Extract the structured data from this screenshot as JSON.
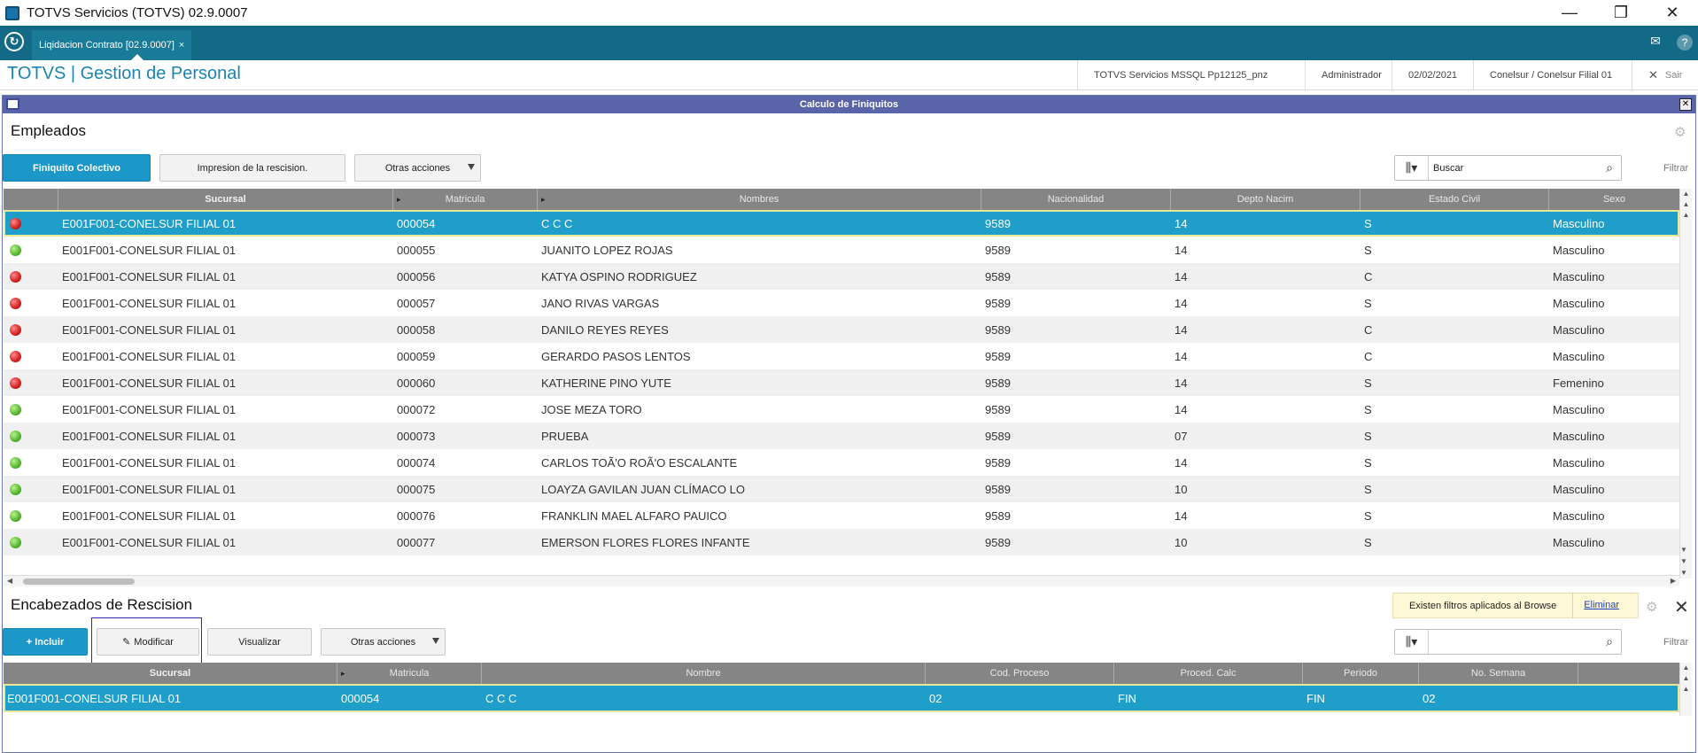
{
  "window": {
    "title": "TOTVS Servicios (TOTVS) 02.9.0007",
    "minimize": "—",
    "restore": "❐",
    "close": "✕"
  },
  "tabbar": {
    "tab_label": "Liqidacion Contrato [02.9.0007]",
    "tab_close": "×",
    "mail_icon": "✉",
    "help_icon": "?"
  },
  "header": {
    "brand": "TOTVS | Gestion de Personal",
    "environment": "TOTVS Servicios MSSQL Pp12125_pnz",
    "user": "Administrador",
    "date": "02/02/2021",
    "branch": "Conelsur / Conelsur Filial 01",
    "exit_icon": "✕",
    "exit_label": "Sair"
  },
  "dialog": {
    "title": "Calculo de Finiquitos",
    "close": "✕"
  },
  "empleados": {
    "title": "Empleados",
    "buttons": {
      "finiquito": "Finiquito Colectivo",
      "impresion": "Impresion de la rescision.",
      "otras": "Otras acciones"
    },
    "search": {
      "value": "Buscar"
    },
    "filter": "Filtrar",
    "columns": [
      "Sucursal",
      "Matricula",
      "Nombres",
      "Nacionalidad",
      "Depto Nacim",
      "Estado Civil",
      "Sexo"
    ],
    "rows": [
      {
        "status": "red",
        "sucursal": "E001F001-CONELSUR FILIAL 01",
        "matricula": "000054",
        "nombres": "C C C",
        "nac": "9589",
        "depto": "14",
        "civil": "S",
        "sexo": "Masculino"
      },
      {
        "status": "green",
        "sucursal": "E001F001-CONELSUR FILIAL 01",
        "matricula": "000055",
        "nombres": "JUANITO LOPEZ ROJAS",
        "nac": "9589",
        "depto": "14",
        "civil": "S",
        "sexo": "Masculino"
      },
      {
        "status": "red",
        "sucursal": "E001F001-CONELSUR FILIAL 01",
        "matricula": "000056",
        "nombres": "KATYA OSPINO RODRIGUEZ",
        "nac": "9589",
        "depto": "14",
        "civil": "C",
        "sexo": "Masculino"
      },
      {
        "status": "red",
        "sucursal": "E001F001-CONELSUR FILIAL 01",
        "matricula": "000057",
        "nombres": "JANO RIVAS VARGAS",
        "nac": "9589",
        "depto": "14",
        "civil": "S",
        "sexo": "Masculino"
      },
      {
        "status": "red",
        "sucursal": "E001F001-CONELSUR FILIAL 01",
        "matricula": "000058",
        "nombres": "DANILO REYES REYES",
        "nac": "9589",
        "depto": "14",
        "civil": "C",
        "sexo": "Masculino"
      },
      {
        "status": "red",
        "sucursal": "E001F001-CONELSUR FILIAL 01",
        "matricula": "000059",
        "nombres": "GERARDO PASOS LENTOS",
        "nac": "9589",
        "depto": "14",
        "civil": "C",
        "sexo": "Masculino"
      },
      {
        "status": "red",
        "sucursal": "E001F001-CONELSUR FILIAL 01",
        "matricula": "000060",
        "nombres": "KATHERINE PINO YUTE",
        "nac": "9589",
        "depto": "14",
        "civil": "S",
        "sexo": "Femenino"
      },
      {
        "status": "green",
        "sucursal": "E001F001-CONELSUR FILIAL 01",
        "matricula": "000072",
        "nombres": "JOSE MEZA TORO",
        "nac": "9589",
        "depto": "14",
        "civil": "S",
        "sexo": "Masculino"
      },
      {
        "status": "green",
        "sucursal": "E001F001-CONELSUR FILIAL 01",
        "matricula": "000073",
        "nombres": "PRUEBA",
        "nac": "9589",
        "depto": "07",
        "civil": "S",
        "sexo": "Masculino"
      },
      {
        "status": "green",
        "sucursal": "E001F001-CONELSUR FILIAL 01",
        "matricula": "000074",
        "nombres": "CARLOS TOÃ'O ROÃ'O ESCALANTE",
        "nac": "9589",
        "depto": "14",
        "civil": "S",
        "sexo": "Masculino"
      },
      {
        "status": "green",
        "sucursal": "E001F001-CONELSUR FILIAL 01",
        "matricula": "000075",
        "nombres": "LOAYZA GAVILAN JUAN CLÍMACO LO",
        "nac": "9589",
        "depto": "10",
        "civil": "S",
        "sexo": "Masculino"
      },
      {
        "status": "green",
        "sucursal": "E001F001-CONELSUR FILIAL 01",
        "matricula": "000076",
        "nombres": "FRANKLIN MAEL ALFARO PAUICO",
        "nac": "9589",
        "depto": "14",
        "civil": "S",
        "sexo": "Masculino"
      },
      {
        "status": "green",
        "sucursal": "E001F001-CONELSUR FILIAL 01",
        "matricula": "000077",
        "nombres": "EMERSON FLORES FLORES INFANTE",
        "nac": "9589",
        "depto": "10",
        "civil": "S",
        "sexo": "Masculino"
      }
    ]
  },
  "encabezados": {
    "title": "Encabezados de Rescision",
    "notice": "Existen filtros aplicados al Browse",
    "notice_link": "Eliminar",
    "close": "✕",
    "buttons": {
      "incluir": "+ Incluir",
      "modificar": "Modificar",
      "visualizar": "Visualizar",
      "otras": "Otras acciones"
    },
    "search": {
      "value": ""
    },
    "filter": "Filtrar",
    "columns": [
      "Sucursal",
      "Matricula",
      "Nombre",
      "Cod. Proceso",
      "Proced. Calc",
      "Periodo",
      "No. Semana"
    ],
    "rows": [
      {
        "sucursal": "E001F001-CONELSUR FILIAL 01",
        "matricula": "000054",
        "nombre": "C C C",
        "cod": "02",
        "proced": "FIN",
        "periodo": "FIN",
        "semana": "02"
      }
    ]
  },
  "colors": {
    "accent": "#1f9ec9",
    "tabbar": "#136a86",
    "dialog_title": "#5a64a8",
    "brand": "#1b84b0"
  }
}
